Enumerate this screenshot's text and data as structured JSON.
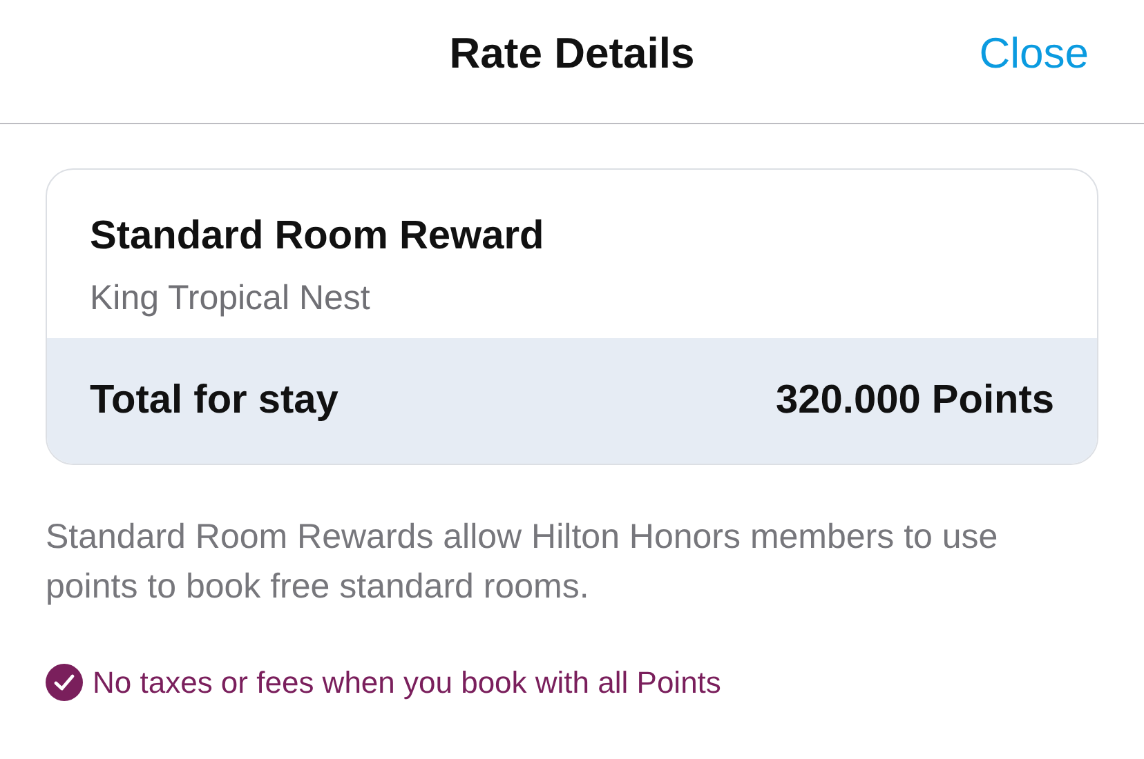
{
  "header": {
    "title": "Rate Details",
    "close": "Close"
  },
  "card": {
    "title": "Standard Room Reward",
    "subtitle": "King Tropical Nest",
    "total_label": "Total for stay",
    "total_value": "320.000 Points"
  },
  "description": "Standard Room Rewards allow Hilton Honors members to use points to book free standard rooms.",
  "benefit": {
    "text": "No taxes or fees when you book with all Points",
    "checked": true
  }
}
